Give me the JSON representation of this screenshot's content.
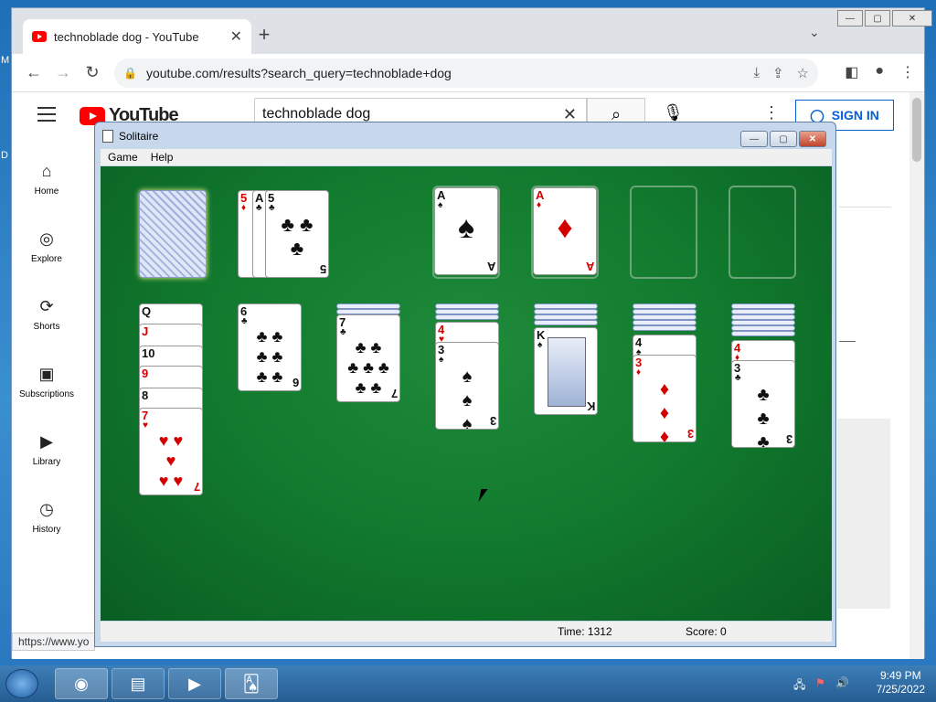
{
  "browser": {
    "tab_title": "technoblade dog - YouTube",
    "new_tab": "+",
    "url": "youtube.com/results?search_query=technoblade+dog",
    "status_url": "https://www.yo"
  },
  "youtube": {
    "logo": "YouTube",
    "search_value": "technoblade dog",
    "sign_in": "SIGN IN",
    "sidebar": [
      {
        "label": "Home",
        "icon": "⌂"
      },
      {
        "label": "Explore",
        "icon": "◎"
      },
      {
        "label": "Shorts",
        "icon": "⟳"
      },
      {
        "label": "Subscriptions",
        "icon": "▣"
      },
      {
        "label": "Library",
        "icon": "▶"
      },
      {
        "label": "History",
        "icon": "◷"
      }
    ]
  },
  "solitaire": {
    "title": "Solitaire",
    "menu": [
      "Game",
      "Help"
    ],
    "time_label": "Time: 1312",
    "score_label": "Score: 0"
  },
  "taskbar": {
    "time": "9:49 PM",
    "date": "7/25/2022"
  },
  "desktop_fragments": [
    "M",
    "D"
  ]
}
